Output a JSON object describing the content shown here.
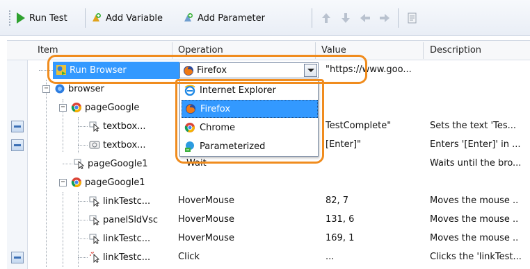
{
  "toolbar": {
    "run_test": "Run Test",
    "add_variable": "Add Variable",
    "add_parameter": "Add Parameter"
  },
  "columns": {
    "item": "Item",
    "operation": "Operation",
    "value": "Value",
    "description": "Description"
  },
  "rows": [
    {
      "item": "Run Browser",
      "operation": "Firefox",
      "value": "\"https://www.goo...",
      "description": ""
    },
    {
      "item": "browser",
      "operation": "",
      "value": "",
      "description": ""
    },
    {
      "item": "pageGoogle",
      "operation": "",
      "value": "",
      "description": ""
    },
    {
      "item": "textbox...",
      "operation": "",
      "value": "TestComplete\"",
      "description": "Sets the text 'Tes..."
    },
    {
      "item": "textbox...",
      "operation": "",
      "value": "[Enter]\"",
      "description": "Enters '[Enter]' in ..."
    },
    {
      "item": "pageGoogle1",
      "operation": "Wait",
      "value": "",
      "description": "Waits until the bro..."
    },
    {
      "item": "pageGoogle1",
      "operation": "",
      "value": "",
      "description": ""
    },
    {
      "item": "linkTestc...",
      "operation": "HoverMouse",
      "value": "82, 7",
      "description": "Moves the mouse .."
    },
    {
      "item": "panelSldVsc",
      "operation": "HoverMouse",
      "value": "131, 6",
      "description": "Moves the mouse .."
    },
    {
      "item": "linkTestc...",
      "operation": "HoverMouse",
      "value": "169, 1",
      "description": "Moves the mouse .."
    },
    {
      "item": "linkTestc...",
      "operation": "Click",
      "value": "...",
      "description": "Clicks the 'linkTest..."
    }
  ],
  "dropdown": {
    "selected": "Firefox",
    "options": [
      "Internet Explorer",
      "Firefox",
      "Chrome",
      "Parameterized"
    ]
  },
  "colors": {
    "selection": "#3399ff",
    "callout": "#f08c1e"
  },
  "icons": [
    "play-icon",
    "add-variable-icon",
    "add-parameter-icon",
    "arrow-up-icon",
    "arrow-down-icon",
    "arrow-left-icon",
    "arrow-right-icon",
    "notes-icon",
    "run-browser-icon",
    "firefox-icon",
    "browser-icon",
    "chrome-icon",
    "cursor-icon",
    "keyboard-icon",
    "ie-icon",
    "parameterized-icon"
  ]
}
